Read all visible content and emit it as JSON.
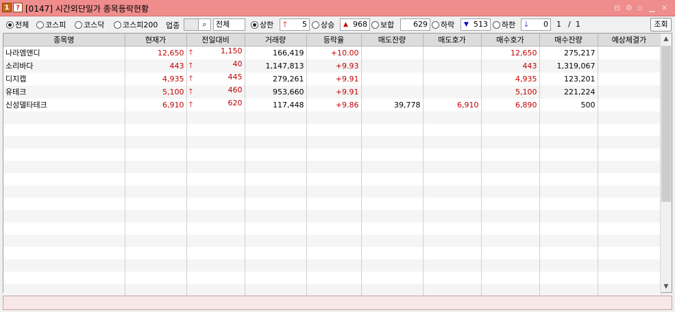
{
  "window": {
    "badge1": "1",
    "badge2": "?",
    "title": "[0147] 시간외단일가 종목등락현황"
  },
  "toolbar": {
    "market_options": [
      {
        "label": "전체",
        "selected": true
      },
      {
        "label": "코스피",
        "selected": false
      },
      {
        "label": "코스닥",
        "selected": false
      },
      {
        "label": "코스피200",
        "selected": false
      }
    ],
    "sector_label": "업종",
    "sector_value": "전체",
    "upper_limit": {
      "label": "상한",
      "count": "5"
    },
    "rise": {
      "label": "상승",
      "count": "968"
    },
    "flat": {
      "label": "보합",
      "count": "629"
    },
    "fall": {
      "label": "하락",
      "count": "513"
    },
    "lower_limit": {
      "label": "하한",
      "count": "0"
    },
    "page_current": "1",
    "page_sep": "/",
    "page_total": "1",
    "query_button": "조회"
  },
  "table": {
    "columns": [
      "종목명",
      "현재가",
      "전일대비",
      "거래량",
      "등락율",
      "매도잔량",
      "매도호가",
      "매수호가",
      "매수잔량",
      "예상체결가"
    ],
    "rows": [
      {
        "name": "나라엠앤디",
        "price": "12,650",
        "change": "1,150",
        "volume": "166,419",
        "rate": "+10.00",
        "ask_qty": "",
        "ask_price": "",
        "bid_price": "12,650",
        "bid_qty": "275,217",
        "expected": ""
      },
      {
        "name": "소리바다",
        "price": "443",
        "change": "40",
        "volume": "1,147,813",
        "rate": "+9.93",
        "ask_qty": "",
        "ask_price": "",
        "bid_price": "443",
        "bid_qty": "1,319,067",
        "expected": ""
      },
      {
        "name": "디지캡",
        "price": "4,935",
        "change": "445",
        "volume": "279,261",
        "rate": "+9.91",
        "ask_qty": "",
        "ask_price": "",
        "bid_price": "4,935",
        "bid_qty": "123,201",
        "expected": ""
      },
      {
        "name": "유테크",
        "price": "5,100",
        "change": "460",
        "volume": "953,660",
        "rate": "+9.91",
        "ask_qty": "",
        "ask_price": "",
        "bid_price": "5,100",
        "bid_qty": "221,224",
        "expected": ""
      },
      {
        "name": "신성델타테크",
        "price": "6,910",
        "change": "620",
        "volume": "117,448",
        "rate": "+9.86",
        "ask_qty": "39,778",
        "ask_price": "6,910",
        "bid_price": "6,890",
        "bid_qty": "500",
        "expected": ""
      }
    ]
  },
  "colors": {
    "title_bar": "#ef8c8c",
    "price_up": "#c00000",
    "price_down": "#0000c0"
  }
}
